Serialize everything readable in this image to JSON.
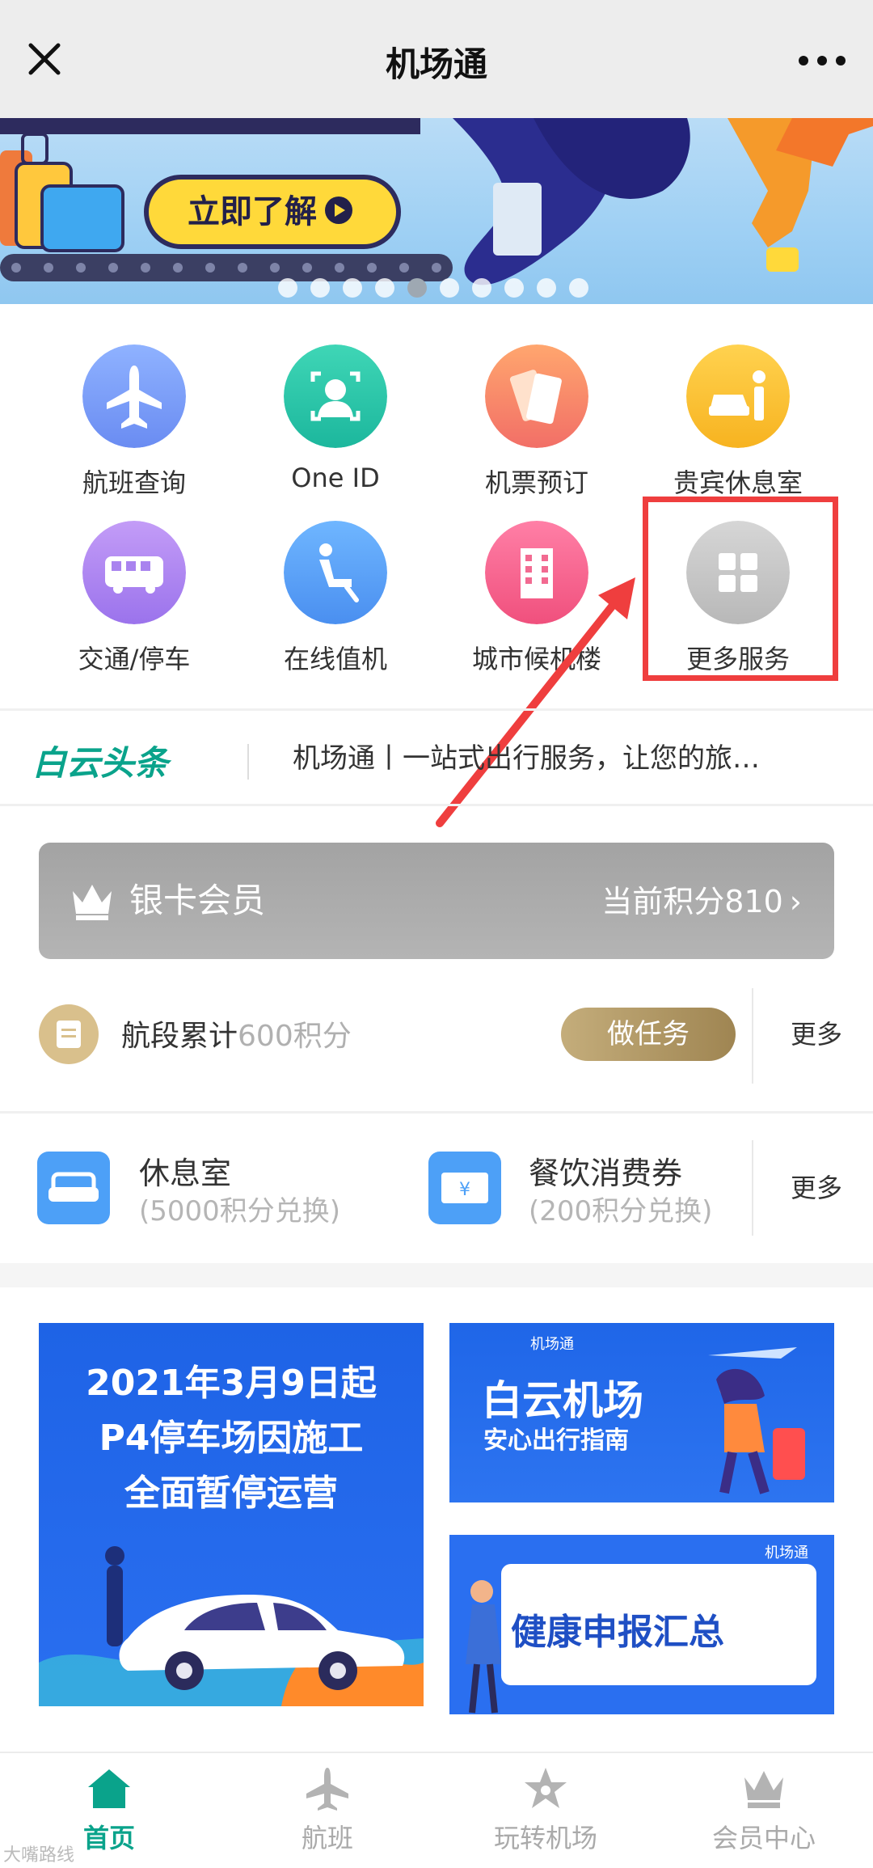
{
  "header": {
    "title": "机场通"
  },
  "banner": {
    "cta_label": "立即了解"
  },
  "services": {
    "row1": [
      {
        "label": "航班查询",
        "icon": "plane-icon"
      },
      {
        "label": "One ID",
        "icon": "face-id-icon"
      },
      {
        "label": "机票预订",
        "icon": "ticket-icon"
      },
      {
        "label": "贵宾休息室",
        "icon": "vip-lounge-icon"
      }
    ],
    "row2": [
      {
        "label": "交通/停车",
        "icon": "bus-icon"
      },
      {
        "label": "在线值机",
        "icon": "seat-icon"
      },
      {
        "label": "城市候机楼",
        "icon": "building-icon"
      },
      {
        "label": "更多服务",
        "icon": "grid-icon"
      }
    ]
  },
  "news": {
    "logo": "白云头条",
    "headline": "机场通丨一站式出行服务，让您的旅…"
  },
  "member": {
    "tier": "银卡会员",
    "points_label": "当前积分810"
  },
  "task": {
    "title": "航段累计",
    "points": "600积分",
    "button": "做任务",
    "more": "更多"
  },
  "benefits": {
    "items": [
      {
        "title": "休息室",
        "sub": "(5000积分兑换)"
      },
      {
        "title": "餐饮消费券",
        "sub": "(200积分兑换)"
      }
    ],
    "more": "更多"
  },
  "promos": {
    "left": {
      "line1": "2021年3月9日起",
      "line2": "P4停车场因施工",
      "line3": "全面暂停运营"
    },
    "top_right": {
      "brand": "机场通",
      "title": "白云机场",
      "subtitle": "安心出行指南"
    },
    "bottom_right": {
      "brand": "机场通",
      "title": "健康申报汇总"
    }
  },
  "nav": {
    "items": [
      "首页",
      "航班",
      "玩转机场",
      "会员中心"
    ]
  },
  "watermark": "大嘴路线",
  "colors": {
    "accent": "#0aa38b",
    "highlight": "#ef3e3e",
    "promo_blue": "#1f5fe0"
  }
}
